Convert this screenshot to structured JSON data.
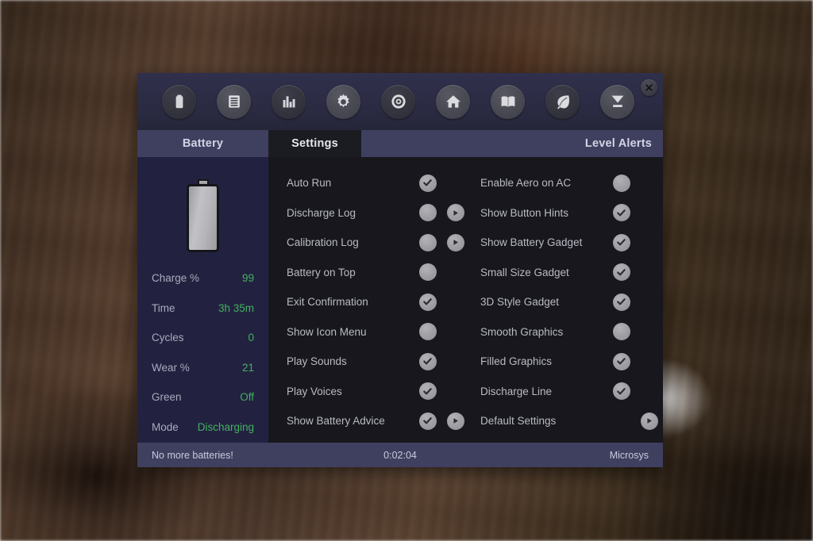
{
  "window": {
    "close_label": "×",
    "accent_navy": "#3f3f60",
    "panel_dark": "#17171d",
    "sidebar_navy": "#222240",
    "green": "#43b05f"
  },
  "toolbar": {
    "buttons": [
      {
        "name": "battery-icon",
        "dim": true
      },
      {
        "name": "list-icon",
        "dim": false
      },
      {
        "name": "bar-chart-icon",
        "dim": true
      },
      {
        "name": "gear-icon",
        "dim": false
      },
      {
        "name": "target-icon",
        "dim": true
      },
      {
        "name": "home-icon",
        "dim": false
      },
      {
        "name": "book-icon",
        "dim": false
      },
      {
        "name": "leaf-icon",
        "dim": true
      },
      {
        "name": "download-icon",
        "dim": false
      }
    ]
  },
  "tabs": [
    {
      "label": "Battery",
      "active": false
    },
    {
      "label": "Settings",
      "active": true
    },
    {
      "label": "Level Alerts",
      "active": false
    }
  ],
  "sidebar": {
    "battery_icon": "battery-full-icon",
    "stats": [
      {
        "label": "Charge %",
        "value": "99"
      },
      {
        "label": "Time",
        "value": "3h 35m"
      },
      {
        "label": "Cycles",
        "value": "0"
      },
      {
        "label": "Wear %",
        "value": "21"
      },
      {
        "label": "Green",
        "value": "Off"
      },
      {
        "label": "Mode",
        "value": "Discharging"
      }
    ]
  },
  "settings": {
    "left_column": [
      {
        "label": "Auto Run",
        "checked": true,
        "arrow": false
      },
      {
        "label": "Discharge Log",
        "checked": false,
        "arrow": true
      },
      {
        "label": "Calibration Log",
        "checked": false,
        "arrow": true
      },
      {
        "label": "Battery on Top",
        "checked": false,
        "arrow": false
      },
      {
        "label": "Exit Confirmation",
        "checked": true,
        "arrow": false
      },
      {
        "label": "Show Icon Menu",
        "checked": false,
        "arrow": false
      },
      {
        "label": "Play Sounds",
        "checked": true,
        "arrow": false
      },
      {
        "label": "Play Voices",
        "checked": true,
        "arrow": false
      },
      {
        "label": "Show Battery Advice",
        "checked": true,
        "arrow": true
      }
    ],
    "right_column": [
      {
        "label": "Enable Aero on AC",
        "checked": false,
        "arrow": false
      },
      {
        "label": "Show Button Hints",
        "checked": true,
        "arrow": false
      },
      {
        "label": "Show Battery Gadget",
        "checked": true,
        "arrow": false
      },
      {
        "label": "Small Size Gadget",
        "checked": true,
        "arrow": false
      },
      {
        "label": "3D Style Gadget",
        "checked": true,
        "arrow": false
      },
      {
        "label": "Smooth Graphics",
        "checked": false,
        "arrow": false
      },
      {
        "label": "Filled Graphics",
        "checked": true,
        "arrow": false
      },
      {
        "label": "Discharge Line",
        "checked": true,
        "arrow": false
      },
      {
        "label": "Default Settings",
        "checked": null,
        "arrow": true
      }
    ]
  },
  "status_bar": {
    "left": "No more batteries!",
    "center": "0:02:04",
    "right": "Microsys"
  }
}
